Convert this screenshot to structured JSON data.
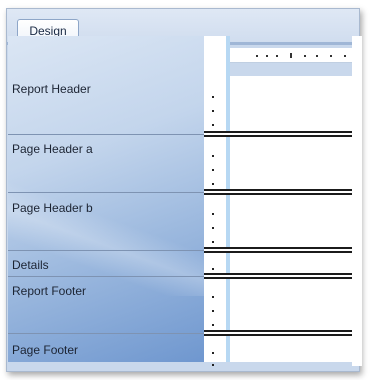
{
  "tabs": [
    {
      "label": "Design"
    }
  ],
  "sections": [
    {
      "label": "Report Header"
    },
    {
      "label": "Page Header a"
    },
    {
      "label": "Page Header b"
    },
    {
      "label": "Details"
    },
    {
      "label": "Report Footer"
    },
    {
      "label": "Page Footer"
    }
  ],
  "colors": {
    "frame": "#c9d8ec",
    "band_gradient_dark": "#6f97cf",
    "ruler_accent": "#b7d8f3",
    "section_bar": "#1b1b1b"
  }
}
